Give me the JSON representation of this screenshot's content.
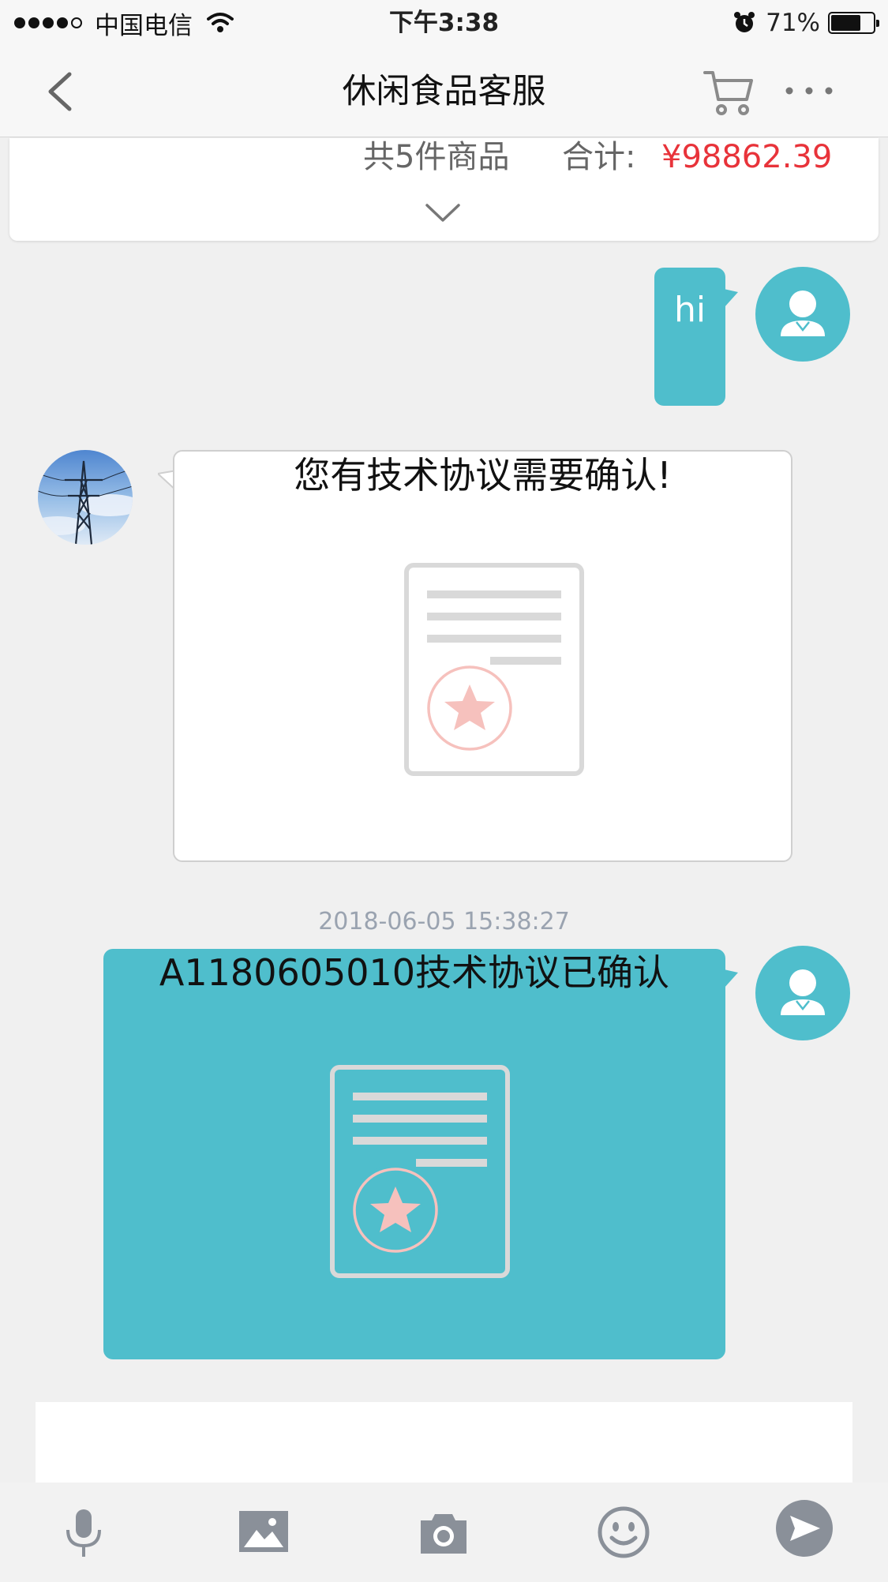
{
  "status_bar": {
    "carrier": "中国电信",
    "time": "下午3:38",
    "battery_percent": "71%",
    "battery_level": 0.71
  },
  "nav": {
    "title": "休闲食品客服",
    "icons": [
      "back-icon",
      "cart-icon",
      "more-icon"
    ]
  },
  "order_summary": {
    "item_count": "共5件商品",
    "total_label": "合计:",
    "total_value": "¥98862.39",
    "total_color": "#e8333a"
  },
  "messages": [
    {
      "sender": "user",
      "text": "hi"
    },
    {
      "sender": "agent",
      "text": "您有技术协议需要确认!",
      "attachment_icon": "contract-document-icon"
    },
    {
      "timestamp": "2018-06-05 15:38:27"
    },
    {
      "sender": "user",
      "text": "A1180605010技术协议已确认",
      "attachment_icon": "contract-document-icon"
    }
  ],
  "toolbar": {
    "icons": [
      "microphone-icon",
      "image-icon",
      "camera-icon",
      "emoji-icon",
      "send-icon"
    ]
  },
  "colors": {
    "accent": "#4fbecc",
    "price": "#e8333a",
    "timestamp": "#9aa3b0",
    "send_button": "#8a9099"
  }
}
